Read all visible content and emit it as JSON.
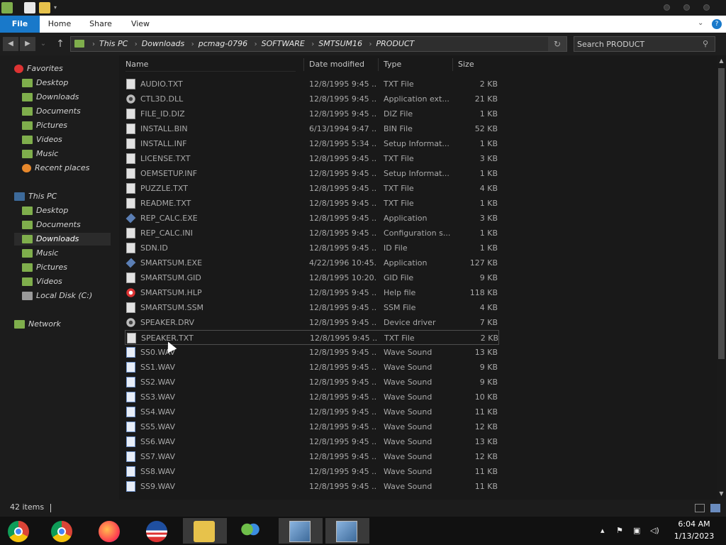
{
  "ribbon": {
    "tabs": [
      "File",
      "Home",
      "Share",
      "View"
    ]
  },
  "address": {
    "crumbs": [
      "This PC",
      "Downloads",
      "pcmag-0796",
      "SOFTWARE",
      "SMTSUM16",
      "PRODUCT"
    ]
  },
  "search": {
    "placeholder": "Search PRODUCT"
  },
  "navpane": {
    "favorites_label": "Favorites",
    "favorites": [
      "Desktop",
      "Downloads",
      "Documents",
      "Pictures",
      "Videos",
      "Music",
      "Recent places"
    ],
    "thispc_label": "This PC",
    "thispc": [
      "Desktop",
      "Documents",
      "Downloads",
      "Music",
      "Pictures",
      "Videos",
      "Local Disk (C:)"
    ],
    "network_label": "Network"
  },
  "columns": {
    "name": "Name",
    "date": "Date modified",
    "type": "Type",
    "size": "Size"
  },
  "files": [
    {
      "name": "AUDIO.TXT",
      "date": "12/8/1995 9:45 ...",
      "type": "TXT File",
      "size": "2 KB",
      "icon": "text-file-icon"
    },
    {
      "name": "CTL3D.DLL",
      "date": "12/8/1995 9:45 ...",
      "type": "Application ext...",
      "size": "21 KB",
      "icon": "gear-icon"
    },
    {
      "name": "FILE_ID.DIZ",
      "date": "12/8/1995 9:45 ...",
      "type": "DIZ File",
      "size": "1 KB",
      "icon": "text-file-icon"
    },
    {
      "name": "INSTALL.BIN",
      "date": "6/13/1994 9:47 ...",
      "type": "BIN File",
      "size": "52 KB",
      "icon": "text-file-icon"
    },
    {
      "name": "INSTALL.INF",
      "date": "12/8/1995 5:34 ...",
      "type": "Setup Informat...",
      "size": "1 KB",
      "icon": "setup-file-icon"
    },
    {
      "name": "LICENSE.TXT",
      "date": "12/8/1995 9:45 ...",
      "type": "TXT File",
      "size": "3 KB",
      "icon": "text-file-icon"
    },
    {
      "name": "OEMSETUP.INF",
      "date": "12/8/1995 9:45 ...",
      "type": "Setup Informat...",
      "size": "1 KB",
      "icon": "setup-file-icon"
    },
    {
      "name": "PUZZLE.TXT",
      "date": "12/8/1995 9:45 ...",
      "type": "TXT File",
      "size": "4 KB",
      "icon": "text-file-icon"
    },
    {
      "name": "README.TXT",
      "date": "12/8/1995 9:45 ...",
      "type": "TXT File",
      "size": "1 KB",
      "icon": "text-file-icon"
    },
    {
      "name": "REP_CALC.EXE",
      "date": "12/8/1995 9:45 ...",
      "type": "Application",
      "size": "3 KB",
      "icon": "application-icon"
    },
    {
      "name": "REP_CALC.INI",
      "date": "12/8/1995 9:45 ...",
      "type": "Configuration s...",
      "size": "1 KB",
      "icon": "setup-file-icon"
    },
    {
      "name": "SDN.ID",
      "date": "12/8/1995 9:45 ...",
      "type": "ID File",
      "size": "1 KB",
      "icon": "text-file-icon"
    },
    {
      "name": "SMARTSUM.EXE",
      "date": "4/22/1996 10:45...",
      "type": "Application",
      "size": "127 KB",
      "icon": "application-icon"
    },
    {
      "name": "SMARTSUM.GID",
      "date": "12/8/1995 10:20...",
      "type": "GID File",
      "size": "9 KB",
      "icon": "text-file-icon"
    },
    {
      "name": "SMARTSUM.HLP",
      "date": "12/8/1995 9:45 ...",
      "type": "Help file",
      "size": "118 KB",
      "icon": "help-file-icon"
    },
    {
      "name": "SMARTSUM.SSM",
      "date": "12/8/1995 9:45 ...",
      "type": "SSM File",
      "size": "4 KB",
      "icon": "text-file-icon"
    },
    {
      "name": "SPEAKER.DRV",
      "date": "12/8/1995 9:45 ...",
      "type": "Device driver",
      "size": "7 KB",
      "icon": "gear-icon"
    },
    {
      "name": "SPEAKER.TXT",
      "date": "12/8/1995 9:45 ...",
      "type": "TXT File",
      "size": "2 KB",
      "icon": "text-file-icon",
      "selected": true
    },
    {
      "name": "SS0.WAV",
      "date": "12/8/1995 9:45 ...",
      "type": "Wave Sound",
      "size": "13 KB",
      "icon": "wave-file-icon"
    },
    {
      "name": "SS1.WAV",
      "date": "12/8/1995 9:45 ...",
      "type": "Wave Sound",
      "size": "9 KB",
      "icon": "wave-file-icon"
    },
    {
      "name": "SS2.WAV",
      "date": "12/8/1995 9:45 ...",
      "type": "Wave Sound",
      "size": "9 KB",
      "icon": "wave-file-icon"
    },
    {
      "name": "SS3.WAV",
      "date": "12/8/1995 9:45 ...",
      "type": "Wave Sound",
      "size": "10 KB",
      "icon": "wave-file-icon"
    },
    {
      "name": "SS4.WAV",
      "date": "12/8/1995 9:45 ...",
      "type": "Wave Sound",
      "size": "11 KB",
      "icon": "wave-file-icon"
    },
    {
      "name": "SS5.WAV",
      "date": "12/8/1995 9:45 ...",
      "type": "Wave Sound",
      "size": "12 KB",
      "icon": "wave-file-icon"
    },
    {
      "name": "SS6.WAV",
      "date": "12/8/1995 9:45 ...",
      "type": "Wave Sound",
      "size": "13 KB",
      "icon": "wave-file-icon"
    },
    {
      "name": "SS7.WAV",
      "date": "12/8/1995 9:45 ...",
      "type": "Wave Sound",
      "size": "12 KB",
      "icon": "wave-file-icon"
    },
    {
      "name": "SS8.WAV",
      "date": "12/8/1995 9:45 ...",
      "type": "Wave Sound",
      "size": "11 KB",
      "icon": "wave-file-icon"
    },
    {
      "name": "SS9.WAV",
      "date": "12/8/1995 9:45 ...",
      "type": "Wave Sound",
      "size": "11 KB",
      "icon": "wave-file-icon"
    }
  ],
  "status": {
    "item_count": "42 items"
  },
  "taskbar": {
    "apps": [
      "chrome-icon",
      "chrome-icon",
      "firefox-icon",
      "obama-logo-icon",
      "file-explorer-icon",
      "users-icon",
      "setup-program-icon",
      "setup-program-icon"
    ],
    "time": "6:04 AM",
    "date": "1/13/2023"
  },
  "colors": {
    "file_tab": "#1979ca",
    "background": "#191919",
    "text_dim": "#a9a9a9"
  }
}
